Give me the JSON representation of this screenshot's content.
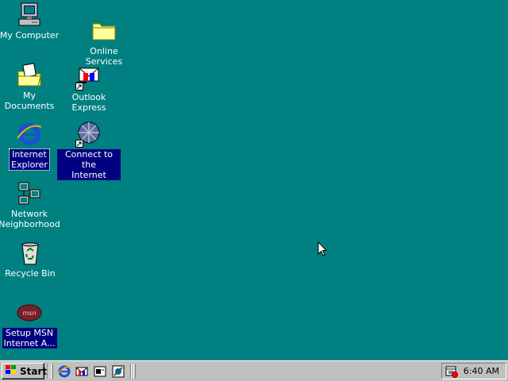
{
  "desktop": {
    "icons": [
      {
        "label": "My Computer"
      },
      {
        "label": "Online\nServices"
      },
      {
        "label": "My Documents"
      },
      {
        "label": "Outlook\nExpress"
      },
      {
        "label": "Internet\nExplorer"
      },
      {
        "label": "Connect to the\nInternet"
      },
      {
        "label": "Network\nNeighborhood"
      },
      {
        "label": "Recycle Bin"
      },
      {
        "label": "Setup MSN\nInternet A..."
      }
    ]
  },
  "taskbar": {
    "start_label": "Start",
    "quick_launch": [
      "internet-explorer-icon",
      "outlook-express-icon",
      "show-desktop-icon",
      "channels-icon"
    ],
    "clock": "6:40 AM"
  },
  "colors": {
    "desktop_bg": "#008080",
    "taskbar_bg": "#c0c0c0",
    "selection": "#000080"
  }
}
